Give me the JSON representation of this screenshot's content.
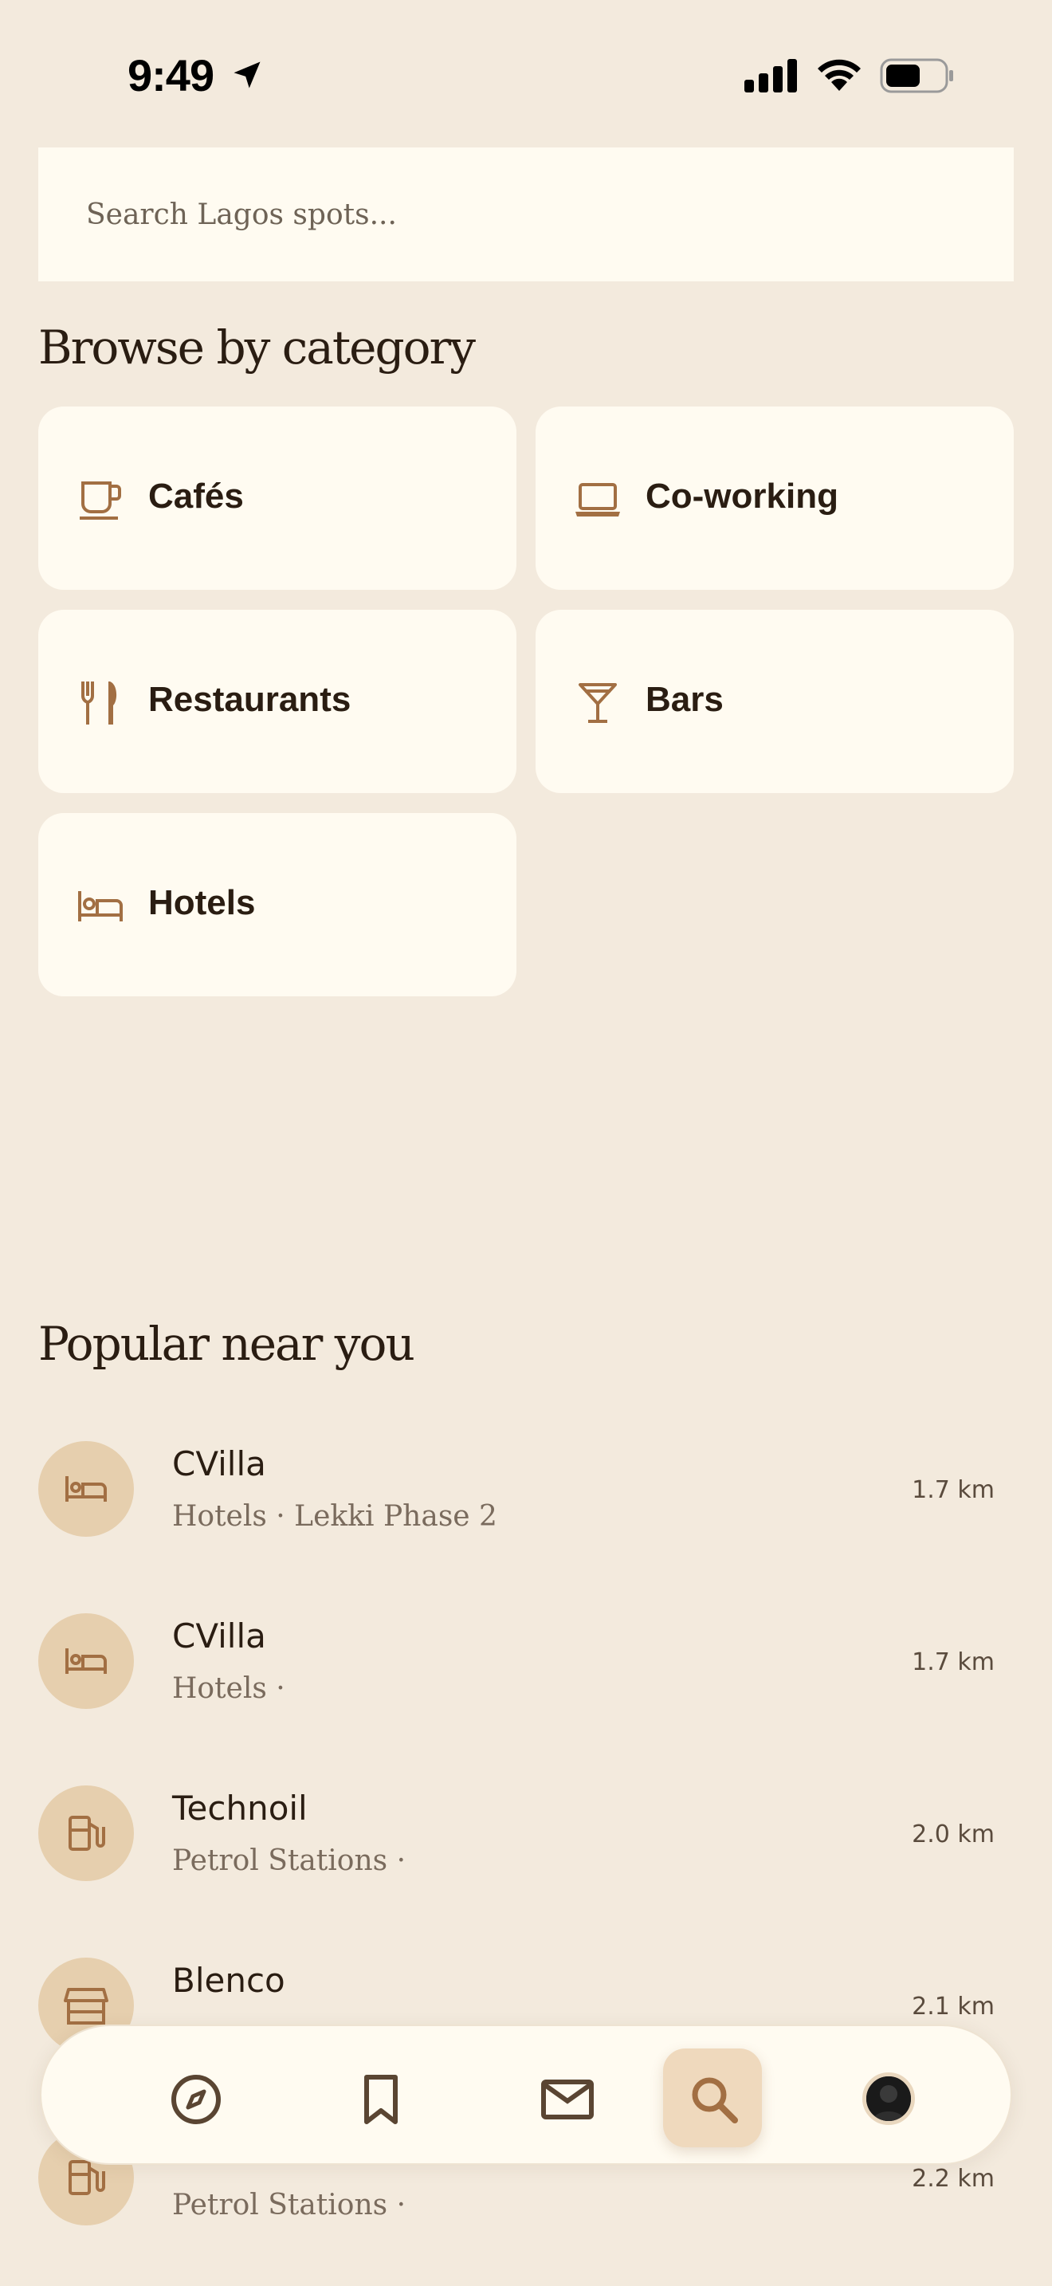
{
  "status": {
    "time": "9:49"
  },
  "search": {
    "placeholder": "Search Lagos spots..."
  },
  "browse": {
    "title": "Browse by category",
    "categories": [
      {
        "label": "Cafés",
        "icon": "coffee-cup-icon"
      },
      {
        "label": "Co-working",
        "icon": "laptop-icon"
      },
      {
        "label": "Restaurants",
        "icon": "fork-knife-icon"
      },
      {
        "label": "Bars",
        "icon": "cocktail-glass-icon"
      },
      {
        "label": "Hotels",
        "icon": "bed-icon"
      }
    ]
  },
  "popular": {
    "title": "Popular near you",
    "items": [
      {
        "name": "CVilla",
        "subtitle": "Hotels · Lekki Phase 2",
        "distance": "1.7 km",
        "icon": "bed-icon"
      },
      {
        "name": "CVilla",
        "subtitle": "Hotels ·",
        "distance": "1.7 km",
        "icon": "bed-icon"
      },
      {
        "name": "Technoil",
        "subtitle": "Petrol Stations ·",
        "distance": "2.0 km",
        "icon": "fuel-pump-icon"
      },
      {
        "name": "Blenco",
        "subtitle": "",
        "distance": "2.1 km",
        "icon": "store-icon"
      },
      {
        "name": "",
        "subtitle": "Petrol Stations ·",
        "distance": "2.2 km",
        "icon": "fuel-pump-icon"
      }
    ]
  },
  "nav": {
    "items": [
      "explore-compass-icon",
      "bookmark-icon",
      "mail-icon",
      "search-icon",
      "profile-avatar"
    ],
    "active": "search-icon"
  },
  "colors": {
    "background": "#f3eadd",
    "card": "#fffbf1",
    "accent": "#a26f43",
    "avatar_bg": "#e6cfae",
    "text": "#2a1d12"
  }
}
